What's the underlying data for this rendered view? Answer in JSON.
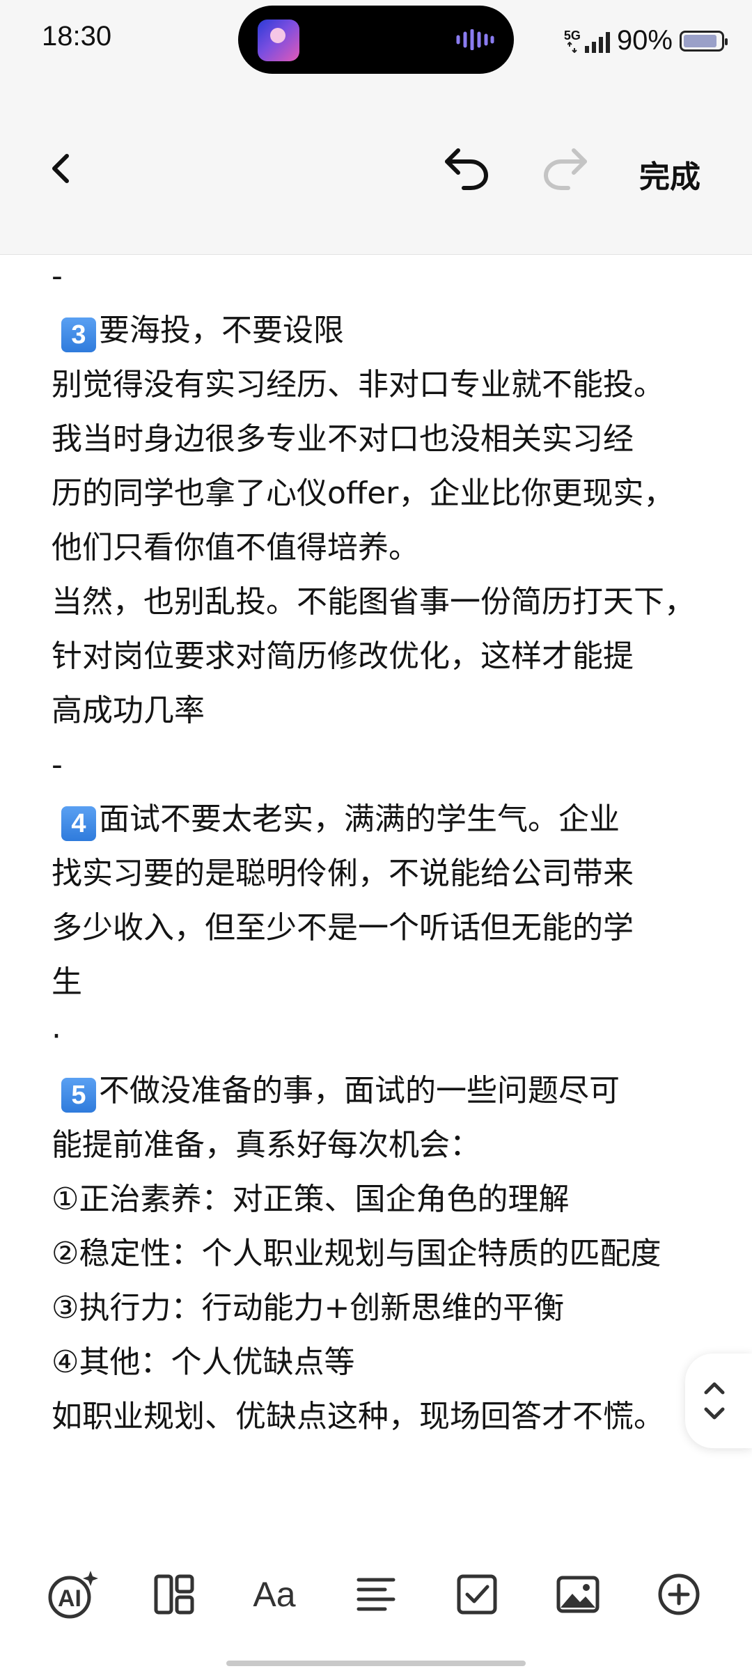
{
  "status_bar": {
    "time": "18:30",
    "network": "5G",
    "battery_percent": "90%",
    "battery_level": 0.9,
    "island_app_icon": "music-app-icon",
    "island_wave_icon": "audio-wave-icon"
  },
  "toolbar": {
    "back_icon": "chevron-left-icon",
    "undo_icon": "undo-icon",
    "redo_icon": "redo-icon",
    "done_label": "完成"
  },
  "note": {
    "lines": [
      "-",
      "要海投，不要设限",
      "别觉得没有实习经历、非对口专业就不能投。",
      "我当时身边很多专业不对口也没相关实习经",
      "历的同学也拿了心仪offer，企业比你更现实，",
      "他们只看你值不值得培养。",
      "当然，也别乱投。不能图省事一份简历打天下，",
      "针对岗位要求对简历修改优化，这样才能提",
      "高成功几率",
      "-",
      "面试不要太老实，满满的学生气。企业",
      "找实习要的是聪明伶俐，不说能给公司带来",
      "多少收入，但至少不是一个听话但无能的学",
      "生",
      "·",
      "不做没准备的事，面试的一些问题尽可",
      "能提前准备，真系好每次机会：",
      "①正治素养：对正策、国企角色的理解",
      "②稳定性：个人职业规划与国企特质的匹配度",
      "③执行力：行动能力+创新思维的平衡",
      "④其他：个人优缺点等",
      "如职业规划、优缺点这种，现场回答才不慌。"
    ],
    "badges": {
      "b3": "3",
      "b4": "4",
      "b5": "5"
    }
  },
  "bottom_toolbar": {
    "ai_label": "AI",
    "text_format_label": "Aa",
    "icons": [
      "ai-assistant-icon",
      "layout-icon",
      "text-format-icon",
      "align-icon",
      "checklist-icon",
      "image-icon",
      "add-icon"
    ]
  },
  "scroll_handle_icon": "scroll-up-down-icon"
}
